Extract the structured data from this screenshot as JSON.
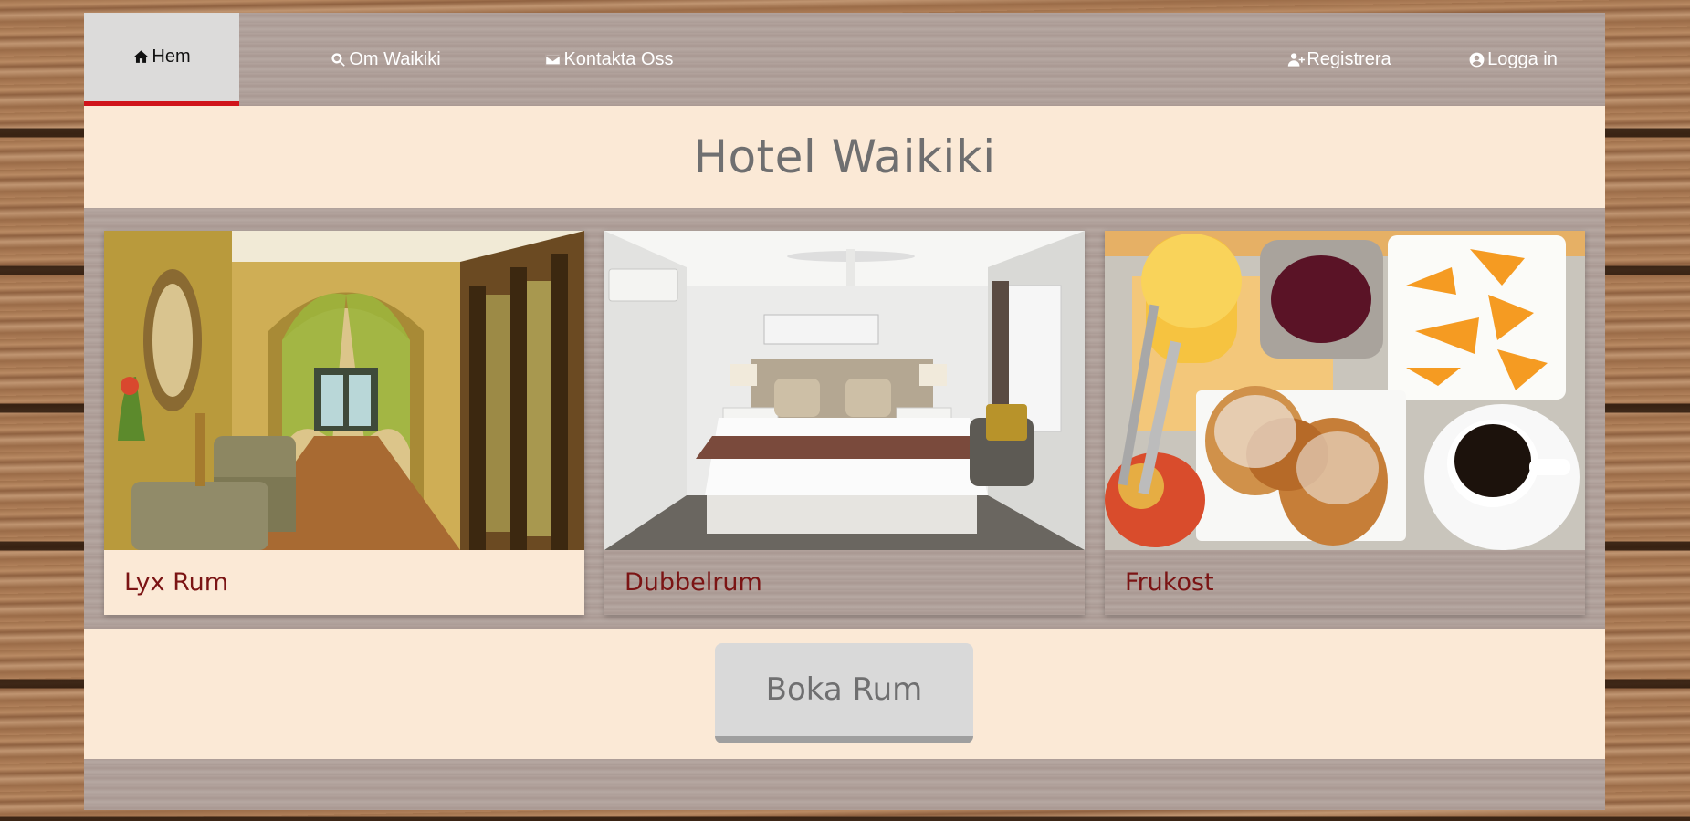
{
  "nav": {
    "home": "Hem",
    "about": "Om Waikiki",
    "contact": "Kontakta Oss",
    "register": "Registrera",
    "login": "Logga in"
  },
  "header": {
    "title": "Hotel Waikiki"
  },
  "cards": [
    {
      "caption": "Lyx Rum"
    },
    {
      "caption": "Dubbelrum"
    },
    {
      "caption": "Frukost"
    }
  ],
  "booking": {
    "button_label": "Boka Rum"
  },
  "colors": {
    "accent": "#d0141b",
    "caption_text": "#7b1414",
    "cream": "#fbe9d6",
    "title_text": "#6f6f70"
  }
}
